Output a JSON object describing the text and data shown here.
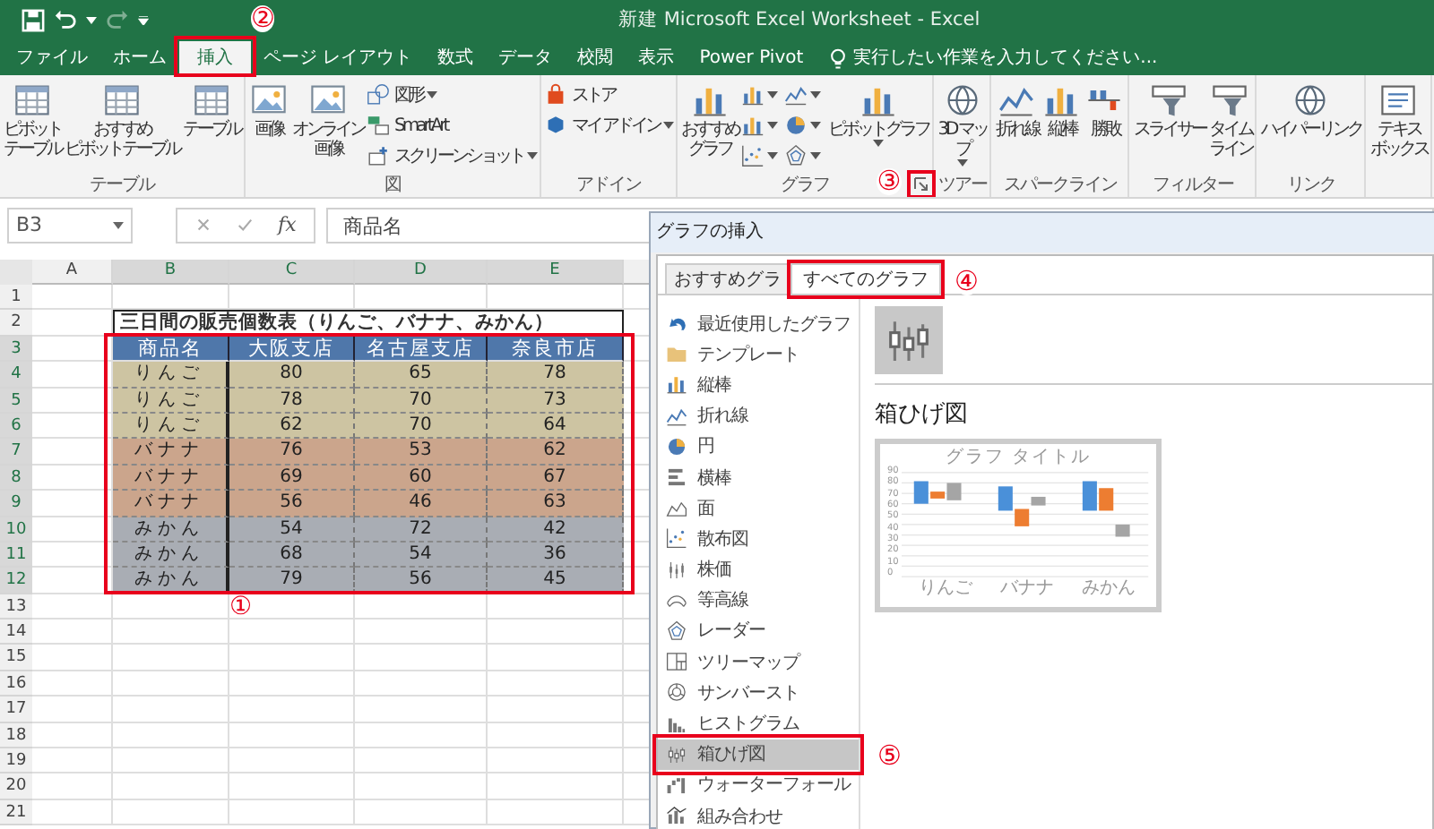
{
  "title_bar": {
    "title": "新建 Microsoft Excel Worksheet - Excel"
  },
  "ribbon_tabs": [
    {
      "label": "ファイル",
      "selected": false
    },
    {
      "label": "ホーム",
      "selected": false
    },
    {
      "label": "挿入",
      "selected": true
    },
    {
      "label": "ページ レイアウト",
      "selected": false
    },
    {
      "label": "数式",
      "selected": false
    },
    {
      "label": "データ",
      "selected": false
    },
    {
      "label": "校閲",
      "selected": false
    },
    {
      "label": "表示",
      "selected": false
    },
    {
      "label": "Power Pivot",
      "selected": false
    }
  ],
  "tell_me": {
    "placeholder": "実行したい作業を入力してください..."
  },
  "ribbon_groups": [
    {
      "label": "テーブル",
      "columns": [
        [
          {
            "kind": "large",
            "lines": [
              "ピボット",
              "テーブル"
            ]
          }
        ],
        [
          {
            "kind": "large",
            "lines": [
              "おすすめ",
              "ピボットテーブル"
            ]
          }
        ],
        [
          {
            "kind": "large",
            "lines": [
              "テーブル"
            ]
          }
        ]
      ]
    },
    {
      "label": "図",
      "columns": [
        [
          {
            "kind": "large",
            "lines": [
              "画像"
            ]
          }
        ],
        [
          {
            "kind": "large",
            "lines": [
              "オンライン",
              "画像"
            ]
          }
        ],
        [
          {
            "kind": "small",
            "label": "図形",
            "dropdown": true
          },
          {
            "kind": "small",
            "label": "SmartArt"
          },
          {
            "kind": "small",
            "label": "スクリーンショット",
            "dropdown": true
          }
        ]
      ]
    },
    {
      "label": "アドイン",
      "columns": [
        [
          {
            "kind": "small",
            "label": "ストア"
          },
          {
            "kind": "small",
            "label": "マイ アドイン",
            "dropdown": true
          }
        ]
      ]
    },
    {
      "label": "グラフ",
      "launcher": true,
      "columns": [
        [
          {
            "kind": "large",
            "lines": [
              "おすすめ",
              "グラフ"
            ]
          }
        ],
        [
          {
            "kind": "icon",
            "dropdown": true
          },
          {
            "kind": "icon",
            "dropdown": true
          },
          {
            "kind": "icon",
            "dropdown": true
          }
        ],
        [
          {
            "kind": "icon",
            "dropdown": true
          },
          {
            "kind": "icon",
            "dropdown": true
          },
          {
            "kind": "icon",
            "dropdown": true
          }
        ],
        [
          {
            "kind": "large",
            "lines": [
              "ピボットグラフ"
            ],
            "dropdown": true
          }
        ]
      ]
    },
    {
      "label": "ツアー",
      "columns": [
        [
          {
            "kind": "large",
            "lines": [
              "3D マッ",
              "プ"
            ],
            "dropdown": true
          }
        ]
      ]
    },
    {
      "label": "スパークライン",
      "columns": [
        [
          {
            "kind": "large",
            "lines": [
              "折れ線"
            ]
          }
        ],
        [
          {
            "kind": "large",
            "lines": [
              "縦棒"
            ]
          }
        ],
        [
          {
            "kind": "large",
            "lines": [
              "勝敗"
            ]
          }
        ]
      ]
    },
    {
      "label": "フィルター",
      "columns": [
        [
          {
            "kind": "large",
            "lines": [
              "スライサー"
            ]
          }
        ],
        [
          {
            "kind": "large",
            "lines": [
              "タイム",
              "ライン"
            ]
          }
        ]
      ]
    },
    {
      "label": "リンク",
      "columns": [
        [
          {
            "kind": "large",
            "lines": [
              "ハイパーリンク"
            ]
          }
        ]
      ]
    },
    {
      "columns": [
        [
          {
            "kind": "large",
            "lines": [
              "テキス",
              "ボックス"
            ]
          }
        ]
      ]
    }
  ],
  "formula_bar": {
    "name_box": "B3",
    "function_label": "fx",
    "formula": "商品名"
  },
  "sheet": {
    "columns": [
      "A",
      "B",
      "C",
      "D",
      "E"
    ],
    "rows": [
      "1",
      "2",
      "3",
      "4",
      "5",
      "6",
      "7",
      "8",
      "9",
      "10",
      "11",
      "12",
      "13",
      "14",
      "15",
      "16",
      "17",
      "18",
      "19",
      "20",
      "21"
    ],
    "title": "三日間の販売個数表（りんご、バナナ、みかん）",
    "header": [
      "商品名",
      "大阪支店",
      "名古屋支店",
      "奈良市店"
    ],
    "data": [
      {
        "cells": [
          "りんご",
          "80",
          "65",
          "78"
        ],
        "color": "#cdc4a2"
      },
      {
        "cells": [
          "りんご",
          "78",
          "70",
          "73"
        ],
        "color": "#cdc4a2"
      },
      {
        "cells": [
          "りんご",
          "62",
          "70",
          "64"
        ],
        "color": "#cdc4a2"
      },
      {
        "cells": [
          "バナナ",
          "76",
          "53",
          "62"
        ],
        "color": "#cba58c"
      },
      {
        "cells": [
          "バナナ",
          "69",
          "60",
          "67"
        ],
        "color": "#cba58c"
      },
      {
        "cells": [
          "バナナ",
          "56",
          "46",
          "63"
        ],
        "color": "#cba58c"
      },
      {
        "cells": [
          "みかん",
          "54",
          "72",
          "42"
        ],
        "color": "#a9adb4"
      },
      {
        "cells": [
          "みかん",
          "68",
          "54",
          "36"
        ],
        "color": "#a9adb4"
      },
      {
        "cells": [
          "みかん",
          "79",
          "56",
          "45"
        ],
        "color": "#a9adb4"
      }
    ]
  },
  "dialog": {
    "title": "グラフの挿入",
    "tabs": [
      {
        "label": "おすすめグラ",
        "selected": false
      },
      {
        "label": "すべてのグラフ",
        "selected": true
      }
    ],
    "chart_types": [
      {
        "label": "最近使用したグラフ",
        "selected": false
      },
      {
        "label": "テンプレート",
        "selected": false
      },
      {
        "label": "縦棒",
        "selected": false
      },
      {
        "label": "折れ線",
        "selected": false
      },
      {
        "label": "円",
        "selected": false
      },
      {
        "label": "横棒",
        "selected": false
      },
      {
        "label": "面",
        "selected": false
      },
      {
        "label": "散布図",
        "selected": false
      },
      {
        "label": "株価",
        "selected": false
      },
      {
        "label": "等高線",
        "selected": false
      },
      {
        "label": "レーダー",
        "selected": false
      },
      {
        "label": "ツリーマップ",
        "selected": false
      },
      {
        "label": "サンバースト",
        "selected": false
      },
      {
        "label": "ヒストグラム",
        "selected": false
      },
      {
        "label": "箱ひげ図",
        "selected": true
      },
      {
        "label": "ウォーターフォール",
        "selected": false
      },
      {
        "label": "組み合わせ",
        "selected": false
      }
    ],
    "subtypes": [
      {
        "selected": true
      }
    ],
    "subtype_title": "箱ひげ図",
    "preview": {
      "title": "グラフ タイトル",
      "yticks": [
        "90",
        "80",
        "70",
        "60",
        "50",
        "40",
        "30",
        "20",
        "10",
        "0"
      ],
      "categories": [
        "りんご",
        "バナナ",
        "みかん"
      ]
    }
  },
  "callouts": [
    "①",
    "②",
    "③",
    "④",
    "⑤"
  ]
}
